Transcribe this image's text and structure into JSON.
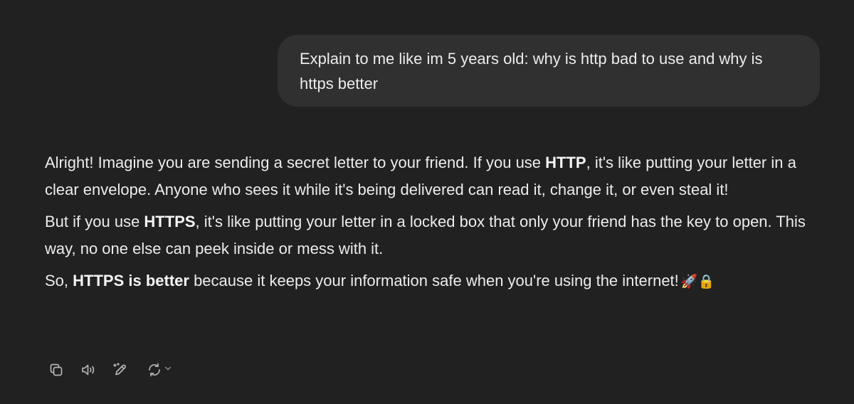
{
  "user_message": {
    "text": "Explain to me like im 5 years old: why is http bad to use and why is https better"
  },
  "assistant_message": {
    "p1": {
      "before": "Alright! Imagine you are sending a secret letter to your friend. If you use ",
      "bold": "HTTP",
      "after": ", it's like putting your letter in a clear envelope. Anyone who sees it while it's being delivered can read it, change it, or even steal it!"
    },
    "p2": {
      "before": "But if you use ",
      "bold": "HTTPS",
      "after": ", it's like putting your letter in a locked box that only your friend has the key to open. This way, no one else can peek inside or mess with it."
    },
    "p3": {
      "before": "So, ",
      "bold": "HTTPS is better",
      "after": " because it keeps your information safe when you're using the internet!",
      "emoji": "🚀🔒"
    }
  },
  "toolbar": {
    "icons": [
      "copy-icon",
      "read-aloud-icon",
      "edit-icon",
      "regenerate-icon",
      "chevron-down-icon"
    ]
  },
  "colors": {
    "background": "#212121",
    "user_bubble": "#303030",
    "text": "#ececec",
    "icon": "#b4b4b4"
  }
}
